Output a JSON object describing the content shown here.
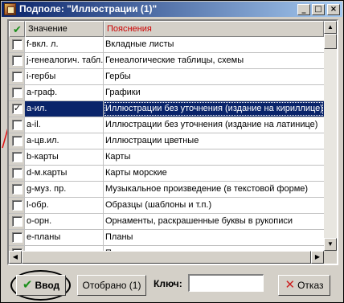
{
  "window": {
    "title": "Подполе: \"Иллюстрации (1)\"",
    "minimize_glyph": "_",
    "maximize_glyph": "□",
    "close_glyph": "×"
  },
  "grid": {
    "header_check_glyph": "✔",
    "col_value": "Значение",
    "col_explanation": "Пояснения",
    "rows": [
      {
        "value": "f-вкл. л.",
        "explanation": "Вкладные листы",
        "checked": false
      },
      {
        "value": "j-генеалогич. табл.",
        "explanation": "Генеалогические таблицы, схемы",
        "checked": false
      },
      {
        "value": "i-гербы",
        "explanation": "Гербы",
        "checked": false
      },
      {
        "value": "a-граф.",
        "explanation": "Графики",
        "checked": false
      },
      {
        "value": "a-ил.",
        "explanation": "Иллюстрации без уточнения (издание на кириллице)",
        "checked": true,
        "selected": true
      },
      {
        "value": "a-il.",
        "explanation": "Иллюстрации без уточнения (издание на латинице)",
        "checked": false
      },
      {
        "value": "a-цв.ил.",
        "explanation": "Иллюстрации цветные",
        "checked": false
      },
      {
        "value": "b-карты",
        "explanation": "Карты",
        "checked": false
      },
      {
        "value": "d-м.карты",
        "explanation": "Карты морские",
        "checked": false
      },
      {
        "value": "g-муз. пр.",
        "explanation": "Музыкальное произведение (в текстовой форме)",
        "checked": false
      },
      {
        "value": "l-обр.",
        "explanation": "Образцы (шаблоны и т.п.)",
        "checked": false
      },
      {
        "value": "o-орн.",
        "explanation": "Орнаменты, раскрашенные буквы в рукописи",
        "checked": false
      },
      {
        "value": "e-планы",
        "explanation": "Планы",
        "checked": false
      },
      {
        "value": "c-портр.",
        "explanation": "Портреты",
        "checked": false
      }
    ]
  },
  "toolbar": {
    "ok_label": "Ввод",
    "selected_label": "Отобрано (1)",
    "key_label": "Ключ:",
    "key_value": "",
    "cancel_label": "Отказ"
  },
  "colors": {
    "titlebar": "#0a246a",
    "selection": "#0a246a",
    "explanation_header": "#cc0000",
    "ok_check": "#1c8f1c",
    "cancel_x": "#cc2222"
  }
}
